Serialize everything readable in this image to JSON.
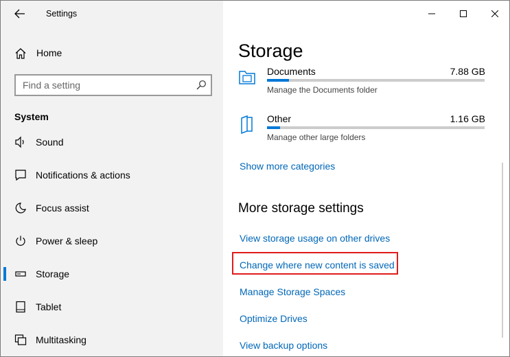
{
  "window": {
    "title": "Settings"
  },
  "sidebar": {
    "home_label": "Home",
    "search_placeholder": "Find a setting",
    "section_label": "System",
    "items": [
      {
        "label": "Sound",
        "icon": "speaker-icon"
      },
      {
        "label": "Notifications & actions",
        "icon": "notification-icon"
      },
      {
        "label": "Focus assist",
        "icon": "moon-icon"
      },
      {
        "label": "Power & sleep",
        "icon": "power-icon"
      },
      {
        "label": "Storage",
        "icon": "storage-drive-icon",
        "active": true
      },
      {
        "label": "Tablet",
        "icon": "tablet-icon"
      },
      {
        "label": "Multitasking",
        "icon": "multitasking-icon"
      }
    ]
  },
  "main": {
    "title": "Storage",
    "categories": [
      {
        "name": "Documents",
        "size": "7.88 GB",
        "subtitle": "Manage the Documents folder",
        "fill": 0.1,
        "icon": "documents-folder-icon"
      },
      {
        "name": "Other",
        "size": "1.16 GB",
        "subtitle": "Manage other large folders",
        "fill": 0.06,
        "icon": "other-folder-icon"
      }
    ],
    "show_more_link": "Show more categories",
    "more_settings_heading": "More storage settings",
    "links": [
      "View storage usage on other drives",
      "Change where new content is saved",
      "Manage Storage Spaces",
      "Optimize Drives",
      "View backup options"
    ]
  },
  "colors": {
    "accent": "#0078d7",
    "link": "#0067b8",
    "highlight": "#e01b1b",
    "sidebar_bg": "#f2f2f2"
  }
}
